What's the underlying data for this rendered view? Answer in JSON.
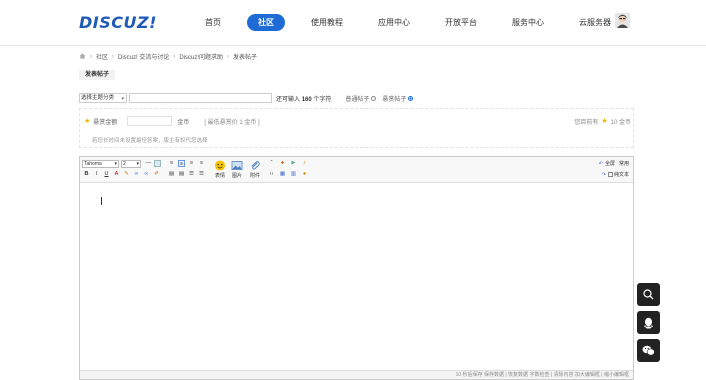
{
  "header": {
    "logo": "DISCUZ!",
    "nav": [
      "首页",
      "社区",
      "使用教程",
      "应用中心",
      "开放平台",
      "服务中心",
      "云服务器"
    ],
    "active_nav": "社区"
  },
  "breadcrumb": [
    "社区",
    "Discuz! 交流与讨论",
    "Discuz!问题求助",
    "发表帖子"
  ],
  "tabs": {
    "post": "发表帖子"
  },
  "post_form": {
    "type_select": "选择主题分类",
    "title_value": "",
    "title_hint_prefix": "还可输入",
    "title_hint_count": "160",
    "title_hint_suffix": "个字符",
    "radio_normal": "普通帖子",
    "radio_reward": "悬赏帖子"
  },
  "reward": {
    "label": "悬赏金额",
    "unit": "金币",
    "min_text": "[ 最低悬赏价 1 金币 ]",
    "have_label": "您目前有",
    "have_amount": "10 金币",
    "note": "若您长时间未设置最佳答案，版主有权代您选择"
  },
  "editor": {
    "font": "Tahoma",
    "size": "2",
    "emoji_label": "表情",
    "image_label": "图片",
    "attach_label": "附件",
    "fullscreen": "全屏",
    "common": "常用",
    "plaintext": "纯文本",
    "status": "10 秒后保存 保存数据 | 恢复数据   字数检查 | 清除内容   加大编辑框 | 缩小编辑框"
  },
  "colors": {
    "accent": "#1e6bd6",
    "logo": "#1e5ab6",
    "star": "#f5b400",
    "float_bg": "#222222"
  },
  "icons": [
    "home-icon",
    "search-icon",
    "qq-icon",
    "wechat-icon",
    "smile-icon",
    "image-icon",
    "attachment-icon"
  ]
}
